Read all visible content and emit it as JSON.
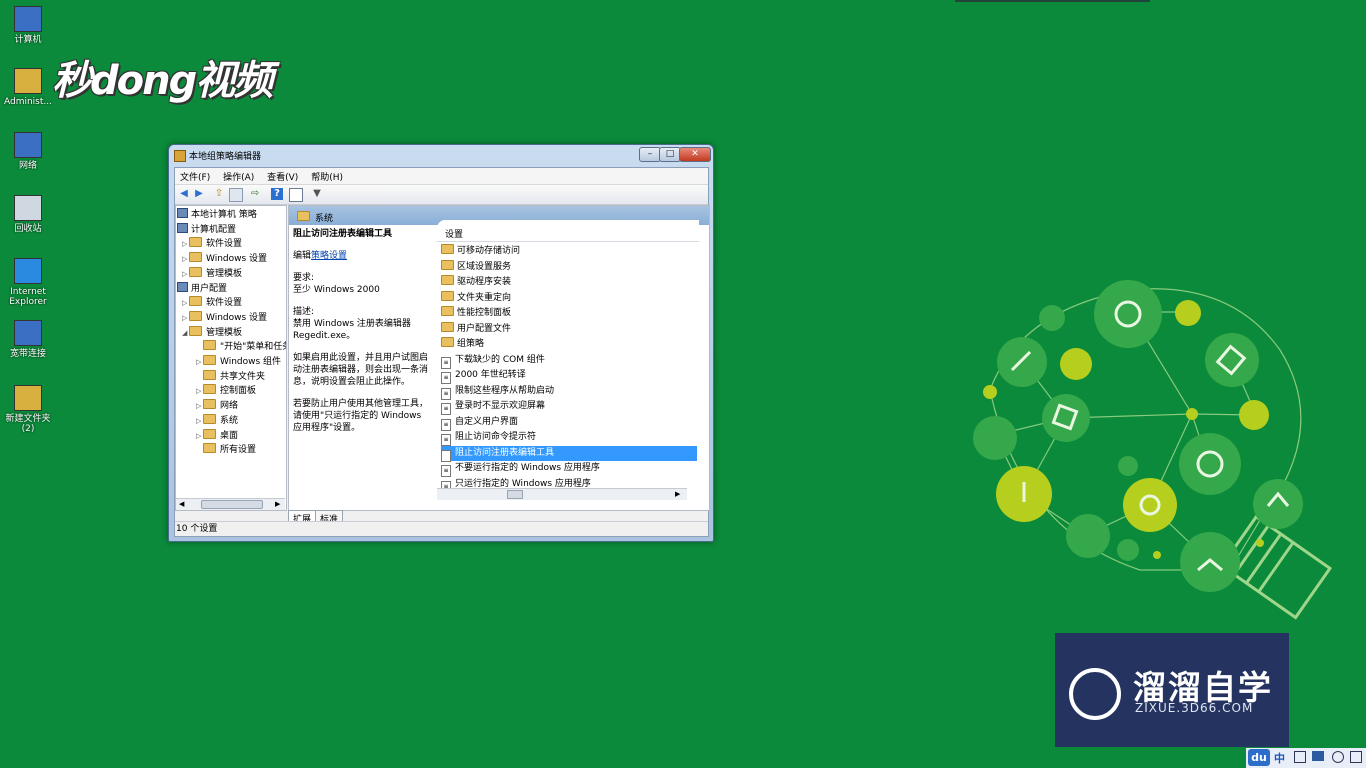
{
  "desktop": {
    "icons": [
      {
        "label": "计算机",
        "icon": "computer-icon"
      },
      {
        "label": "Administ...",
        "icon": "user-folder-icon"
      },
      {
        "label": "网络",
        "icon": "network-icon"
      },
      {
        "label": "回收站",
        "icon": "recycle-bin-icon"
      },
      {
        "label": "Internet Explorer",
        "icon": "ie-icon"
      },
      {
        "label": "宽带连接",
        "icon": "broadband-icon"
      },
      {
        "label": "新建文件夹 (2)",
        "icon": "folder-icon"
      }
    ],
    "watermark_logo": "秒dong视频"
  },
  "window": {
    "title": "本地组策略编辑器",
    "controls": {
      "minimize": "–",
      "maximize": "□",
      "close": "✕"
    },
    "menu": [
      "文件(F)",
      "操作(A)",
      "查看(V)",
      "帮助(H)"
    ],
    "tree": [
      {
        "label": "本地计算机 策略",
        "level": 0,
        "icon": "computer",
        "twisty": ""
      },
      {
        "label": "计算机配置",
        "level": 0,
        "icon": "computer",
        "twisty": "◢"
      },
      {
        "label": "软件设置",
        "level": 1,
        "icon": "folder",
        "twisty": "▷"
      },
      {
        "label": "Windows 设置",
        "level": 1,
        "icon": "folder",
        "twisty": "▷"
      },
      {
        "label": "管理模板",
        "level": 1,
        "icon": "folder",
        "twisty": "▷"
      },
      {
        "label": "用户配置",
        "level": 0,
        "icon": "computer",
        "twisty": "◢"
      },
      {
        "label": "软件设置",
        "level": 1,
        "icon": "folder",
        "twisty": "▷"
      },
      {
        "label": "Windows 设置",
        "level": 1,
        "icon": "folder",
        "twisty": "▷"
      },
      {
        "label": "管理模板",
        "level": 1,
        "icon": "folder",
        "twisty": "◢"
      },
      {
        "label": "\"开始\"菜单和任务",
        "level": 2,
        "icon": "folder",
        "twisty": ""
      },
      {
        "label": "Windows 组件",
        "level": 2,
        "icon": "folder",
        "twisty": "▷"
      },
      {
        "label": "共享文件夹",
        "level": 2,
        "icon": "folder",
        "twisty": ""
      },
      {
        "label": "控制面板",
        "level": 2,
        "icon": "folder",
        "twisty": "▷"
      },
      {
        "label": "网络",
        "level": 2,
        "icon": "folder",
        "twisty": "▷"
      },
      {
        "label": "系统",
        "level": 2,
        "icon": "folder",
        "twisty": "▷"
      },
      {
        "label": "桌面",
        "level": 2,
        "icon": "folder",
        "twisty": "▷"
      },
      {
        "label": "所有设置",
        "level": 2,
        "icon": "folder",
        "twisty": ""
      }
    ],
    "right_header": "系统",
    "description": {
      "title": "阻止访问注册表编辑工具",
      "edit_prefix": "编辑",
      "edit_link": "策略设置",
      "req_label": "要求:",
      "req_value": "至少 Windows 2000",
      "desc_label": "描述:",
      "desc_value": "禁用 Windows 注册表编辑器 Regedit.exe。",
      "para1": "如果启用此设置，并且用户试图启动注册表编辑器，则会出现一条消息，说明设置会阻止此操作。",
      "para2": "若要防止用户使用其他管理工具，请使用\"只运行指定的 Windows 应用程序\"设置。"
    },
    "list_header": "设置",
    "list_items": [
      {
        "label": "可移动存储访问",
        "type": "folder",
        "selected": false
      },
      {
        "label": "区域设置服务",
        "type": "folder",
        "selected": false
      },
      {
        "label": "驱动程序安装",
        "type": "folder",
        "selected": false
      },
      {
        "label": "文件夹重定向",
        "type": "folder",
        "selected": false
      },
      {
        "label": "性能控制面板",
        "type": "folder",
        "selected": false
      },
      {
        "label": "用户配置文件",
        "type": "folder",
        "selected": false
      },
      {
        "label": "组策略",
        "type": "folder",
        "selected": false
      },
      {
        "label": "下载缺少的 COM 组件",
        "type": "policy",
        "selected": false
      },
      {
        "label": "2000 年世纪转译",
        "type": "policy",
        "selected": false
      },
      {
        "label": "限制这些程序从帮助启动",
        "type": "policy",
        "selected": false
      },
      {
        "label": "登录时不显示欢迎屏幕",
        "type": "policy",
        "selected": false
      },
      {
        "label": "自定义用户界面",
        "type": "policy",
        "selected": false
      },
      {
        "label": "阻止访问命令提示符",
        "type": "policy",
        "selected": false
      },
      {
        "label": "阻止访问注册表编辑工具",
        "type": "policy",
        "selected": true
      },
      {
        "label": "不要运行指定的 Windows 应用程序",
        "type": "policy",
        "selected": false
      },
      {
        "label": "只运行指定的 Windows 应用程序",
        "type": "policy",
        "selected": false
      }
    ],
    "tabs": [
      "扩展",
      "标准"
    ],
    "status": "10 个设置"
  },
  "brand": {
    "name": "溜溜自学",
    "url": "ZIXUE.3D66.COM"
  },
  "tray": {
    "du": "du",
    "ime": "中"
  },
  "colors": {
    "desktop_bg": "#0a8a3a",
    "selection": "#3399ff",
    "brand_bg": "#24335f"
  }
}
